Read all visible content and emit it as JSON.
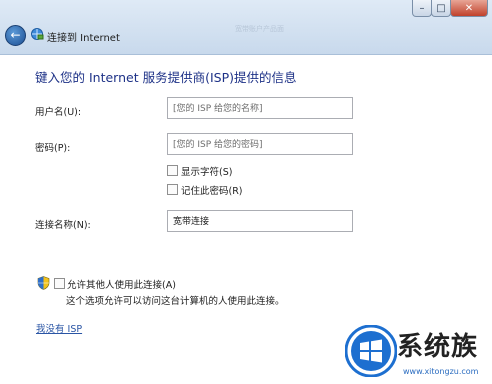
{
  "window": {
    "title": "连接到 Internet",
    "faint_title": "宽带账户产品面",
    "controls": {
      "minimize": "–",
      "maximize": "□",
      "close": "✕"
    }
  },
  "heading": "键入您的 Internet 服务提供商(ISP)提供的信息",
  "fields": {
    "username": {
      "label": "用户名(U):",
      "placeholder": "[您的 ISP 给您的名称]"
    },
    "password": {
      "label": "密码(P):",
      "placeholder": "[您的 ISP 给您的密码]"
    },
    "show_chars": {
      "label": "显示字符(S)",
      "checked": false
    },
    "remember_password": {
      "label": "记住此密码(R)",
      "checked": false
    },
    "connection_name": {
      "label": "连接名称(N):",
      "value": "宽带连接"
    }
  },
  "allow_others": {
    "label": "允许其他人使用此连接(A)",
    "checked": false,
    "note": "这个选项允许可以访问这台计算机的人使用此连接。"
  },
  "no_isp_link": "我没有 ISP",
  "watermark": {
    "text": "系统族",
    "url": "www.xitongzu.com"
  },
  "icons": [
    "back-arrow-icon",
    "network-wizard-icon",
    "uac-shield-icon",
    "windows-logo-icon"
  ]
}
